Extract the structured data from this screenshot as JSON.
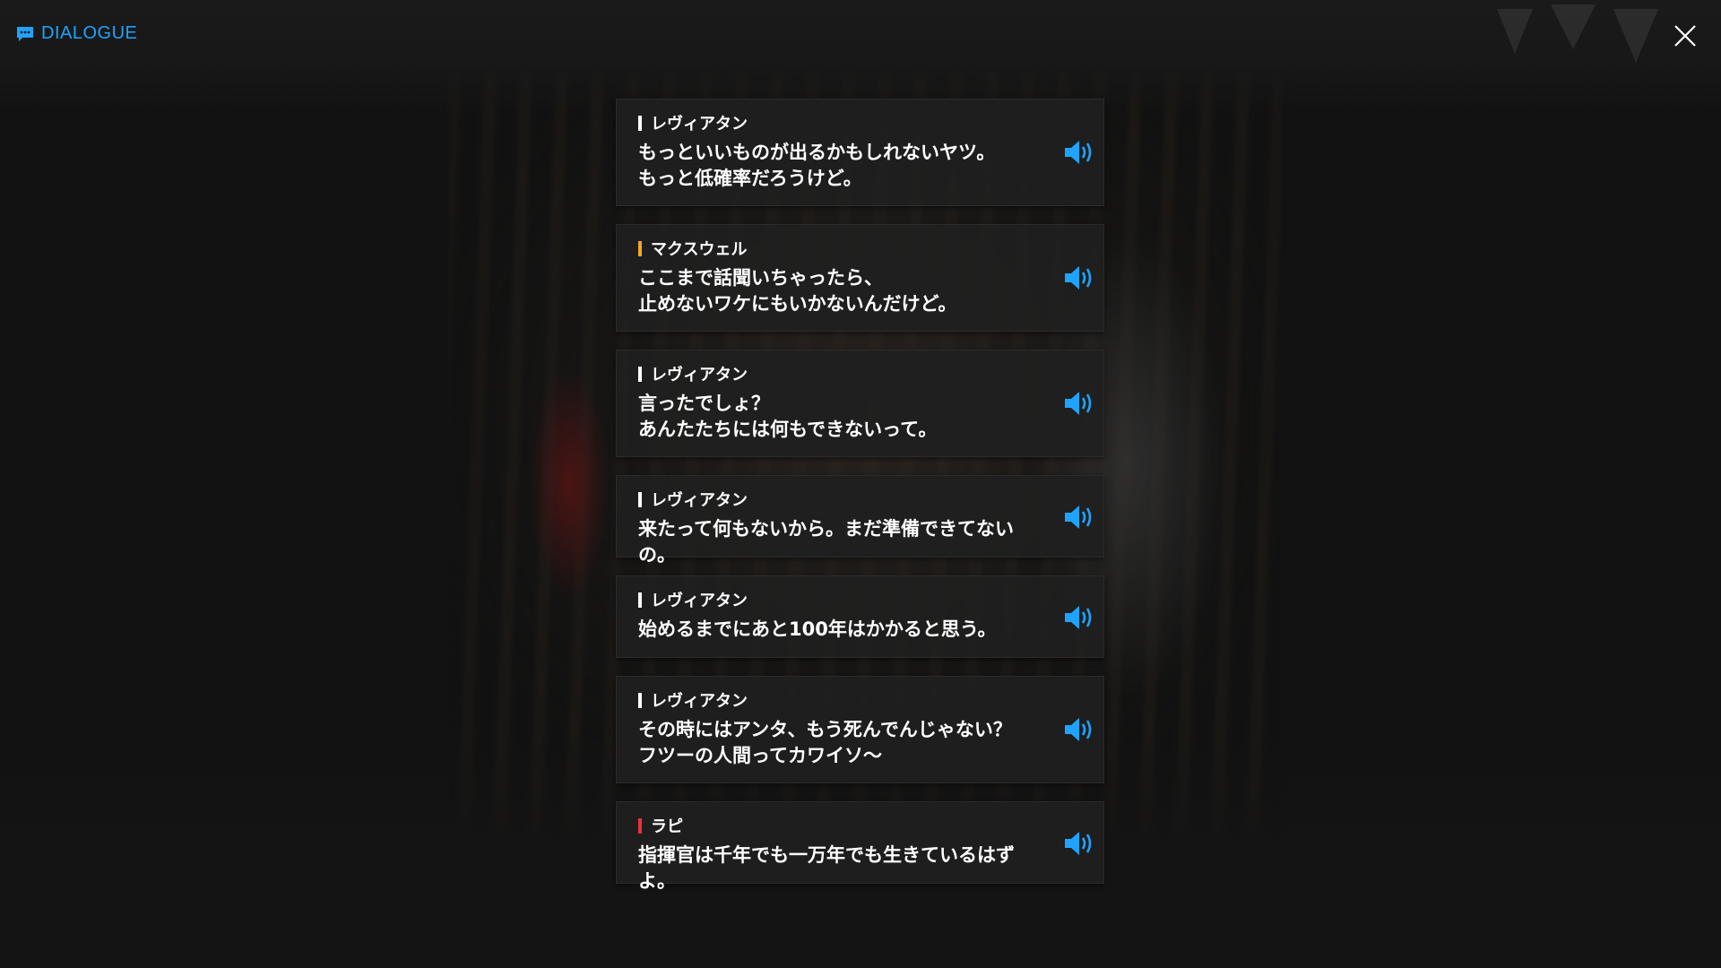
{
  "header": {
    "title": "DIALOGUE",
    "icon": "chat-icon",
    "accent_color": "#1fa3ff"
  },
  "close_icon": "close-icon",
  "voice_icon": "speaker-icon",
  "entries": [
    {
      "speaker": "レヴィアタン",
      "speaker_color": "#ffffff",
      "text": "もっといいものが出るかもしれないヤツ。\nもっと低確率だろうけど。"
    },
    {
      "speaker": "マクスウェル",
      "speaker_color": "#f5a623",
      "text": "ここまで話聞いちゃったら、\n止めないワケにもいかないんだけど。"
    },
    {
      "speaker": "レヴィアタン",
      "speaker_color": "#ffffff",
      "text": "言ったでしょ？\nあんたたちには何もできないって。"
    },
    {
      "speaker": "レヴィアタン",
      "speaker_color": "#ffffff",
      "text": "来たって何もないから。まだ準備できてないの。"
    },
    {
      "speaker": "レヴィアタン",
      "speaker_color": "#ffffff",
      "text": "始めるまでにあと100年はかかると思う。"
    },
    {
      "speaker": "レヴィアタン",
      "speaker_color": "#ffffff",
      "text": "その時にはアンタ、もう死んでんじゃない？\nフツーの人間ってカワイソ～"
    },
    {
      "speaker": "ラピ",
      "speaker_color": "#e8333a",
      "text": "指揮官は千年でも一万年でも生きているはずよ。"
    }
  ]
}
